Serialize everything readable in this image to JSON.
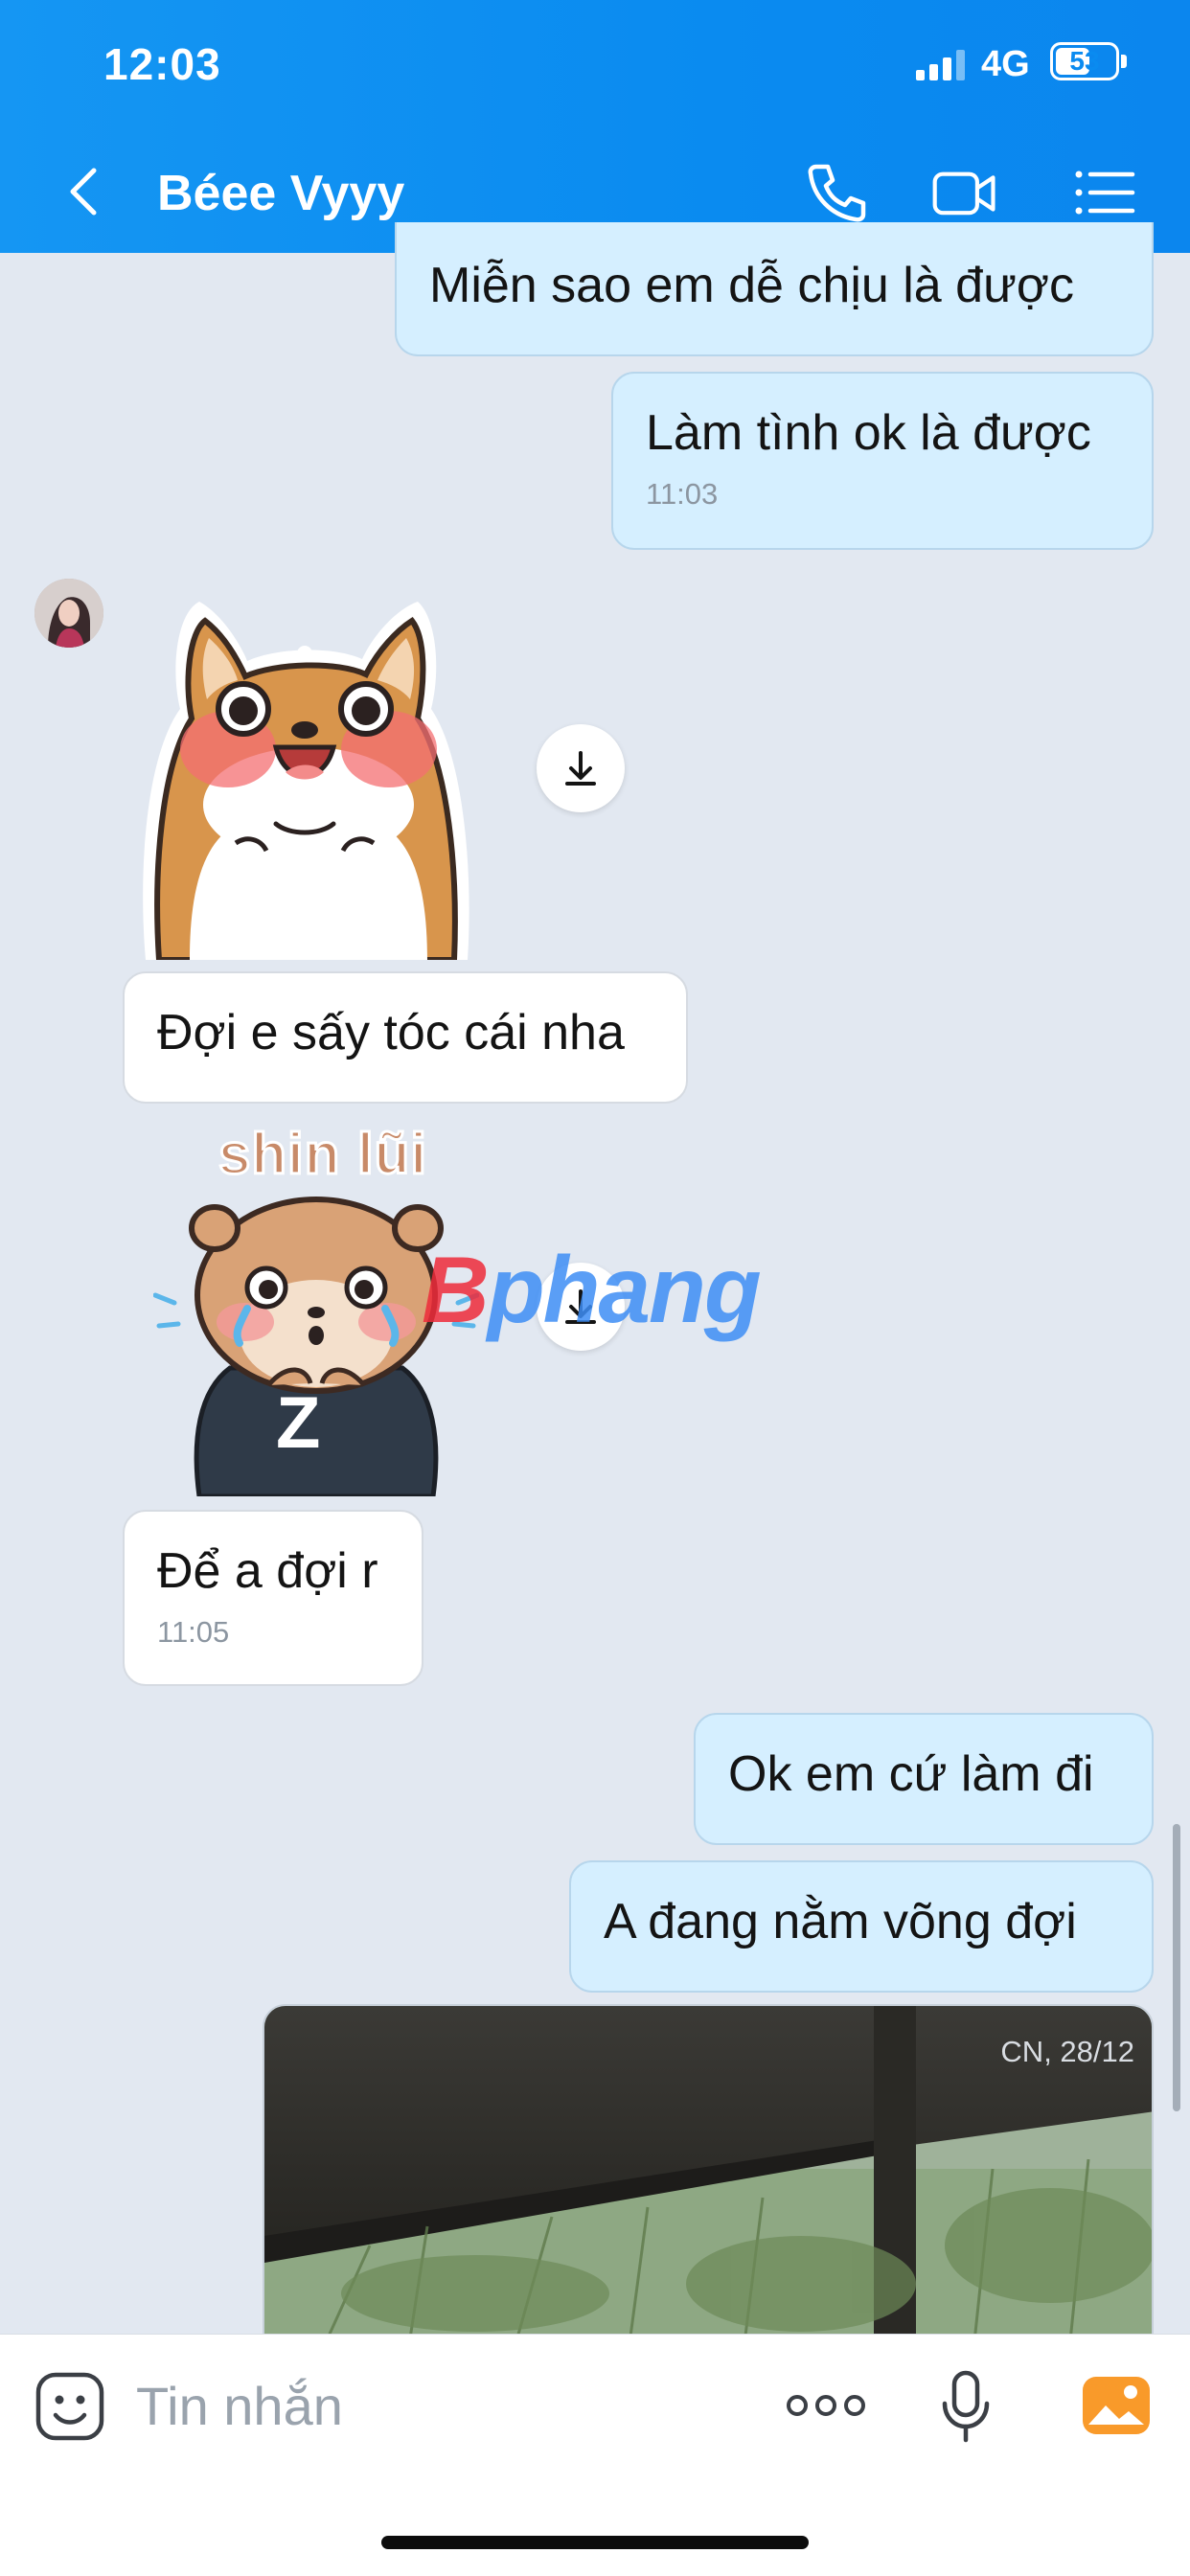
{
  "status_bar": {
    "time": "12:03",
    "network": "4G",
    "battery": "53",
    "battery_level": 0.53
  },
  "header": {
    "contact_name": "Béee Vyyy"
  },
  "messages": {
    "m1": {
      "text": "Miễn sao em dễ chịu là được"
    },
    "m2": {
      "text": "Làm tình ok là được",
      "time": "11:03"
    },
    "m3": {
      "text": "Đợi e sấy tóc cái nha"
    },
    "m4": {
      "text": "Để a đợi r",
      "time": "11:05"
    },
    "m5": {
      "text": "Ok em cứ làm đi"
    },
    "m6": {
      "text": "A đang nằm võng đợi"
    }
  },
  "sticker2": {
    "caption": "shin lũi",
    "letter": "Z"
  },
  "watermark": {
    "first": "B",
    "rest": "phang"
  },
  "photo": {
    "date": "CN, 28/12"
  },
  "composer": {
    "placeholder": "Tin nhắn"
  }
}
